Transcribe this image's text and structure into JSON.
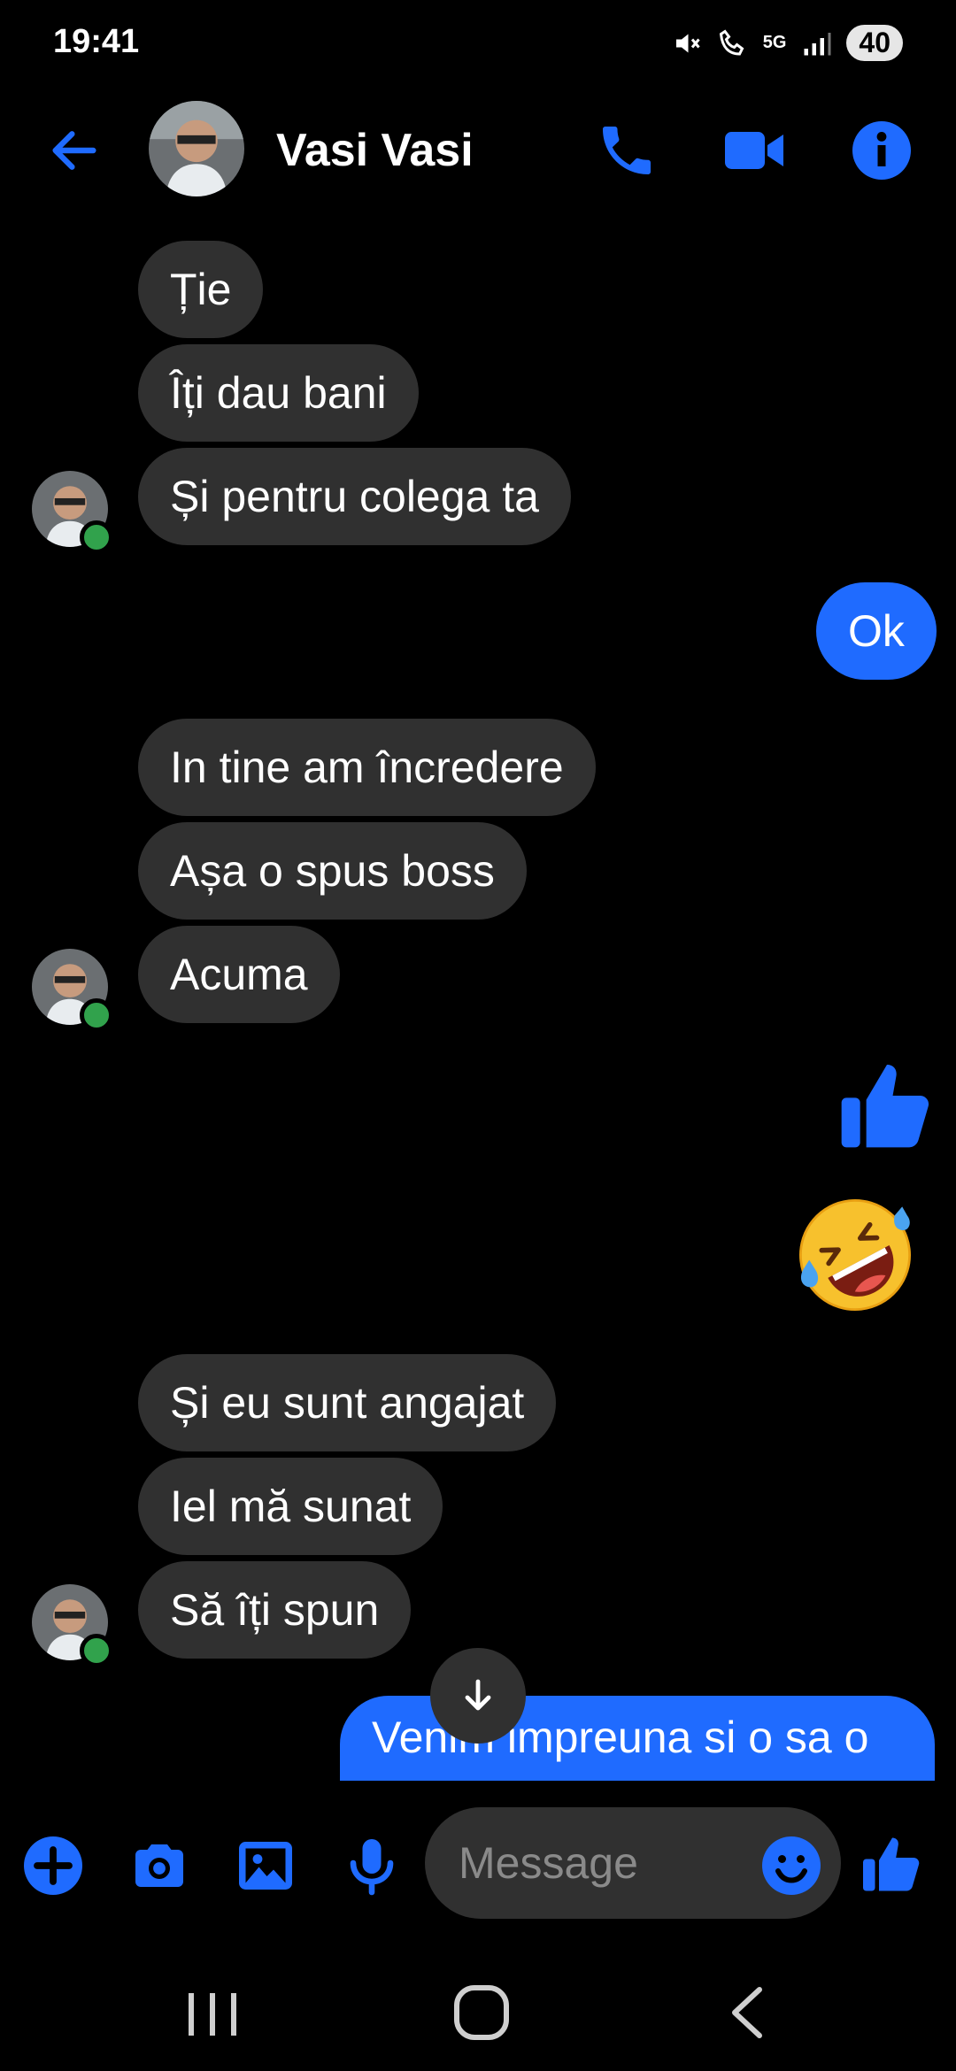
{
  "status_bar": {
    "time": "19:41",
    "battery": "40",
    "network": "5G"
  },
  "header": {
    "contact_name": "Vasi Vasi"
  },
  "messages": [
    {
      "text": "Ție",
      "dir": "in"
    },
    {
      "text": "Îți dau bani",
      "dir": "in"
    },
    {
      "text": "Și pentru colega ta",
      "dir": "in"
    },
    {
      "text": "Ok",
      "dir": "out"
    },
    {
      "text": "In tine am încredere",
      "dir": "in"
    },
    {
      "text": "Așa o spus boss",
      "dir": "in"
    },
    {
      "text": "Acuma",
      "dir": "in"
    },
    {
      "text": "👍",
      "dir": "out",
      "kind": "like-sticker"
    },
    {
      "text": "🤣",
      "dir": "out",
      "kind": "emoji"
    },
    {
      "text": "Și eu sunt angajat",
      "dir": "in"
    },
    {
      "text": "Iel mă sunat",
      "dir": "in"
    },
    {
      "text": "Să îți spun",
      "dir": "in"
    },
    {
      "text": "Venim impreuna si o sa o",
      "dir": "out"
    }
  ],
  "composer": {
    "placeholder": "Message"
  },
  "colors": {
    "accent": "#1f6bff",
    "incoming_bubble": "#303030",
    "online": "#31a24c"
  }
}
